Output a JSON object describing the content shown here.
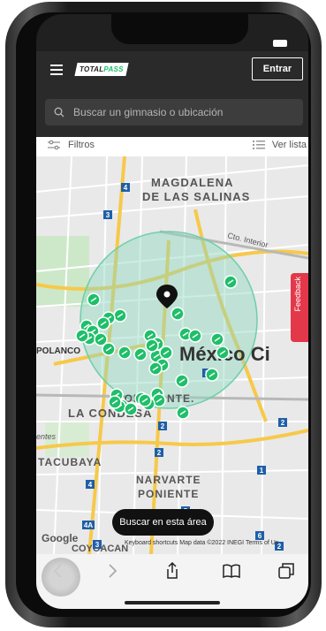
{
  "header": {
    "logo_text_a": "TOTAL",
    "logo_text_b": "PASS",
    "enter_label": "Entrar"
  },
  "search": {
    "placeholder": "Buscar un gimnasio o ubicación"
  },
  "filters": {
    "filters_label": "Filtros",
    "list_label": "Ver lista"
  },
  "map": {
    "labels": {
      "magdalena": "MAGDALENA",
      "salinas": "DE LAS SALINAS",
      "polanco": "POLANCO",
      "mexico_city": "México Ci",
      "roma": "ROMA",
      "nte": "NTE.",
      "condesa": "LA CONDESA",
      "tacubaya": "TACUBAYA",
      "narvarte": "NARVARTE",
      "poniente": "PONIENTE",
      "cto_interior": "Cto. Interior",
      "entes": "entes",
      "coyoacan": "COYOACAN"
    },
    "road_shields": [
      "4",
      "3",
      "1",
      "2",
      "2",
      "2",
      "1",
      "4",
      "5",
      "4A",
      "6",
      "2",
      "3"
    ],
    "accent_color": "#1fbf6a",
    "search_area_label": "Buscar en esta área",
    "attribution": "Keyboard shortcuts  Map data ©2022 INEGI   Terms of Us",
    "google_label": "Google",
    "feedback_label": "Feedback"
  },
  "browser": {
    "icons": [
      "back-icon",
      "forward-icon",
      "share-icon",
      "bookmarks-icon",
      "tabs-icon"
    ]
  }
}
